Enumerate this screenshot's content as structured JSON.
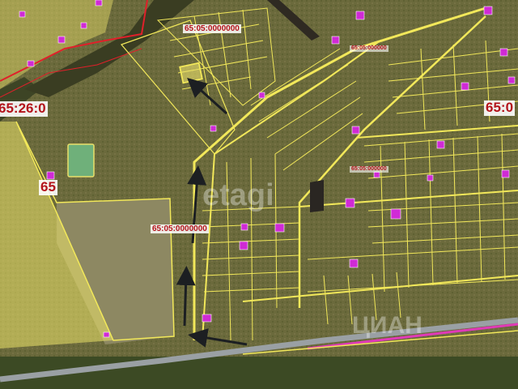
{
  "labels": {
    "parcel_top": "65:05:0000000",
    "parcel_mid": "65:05:0000000",
    "block_small_a": "65:05:000000",
    "block_small_b": "65:05:000000",
    "zone_left": "65:26:0",
    "zone_left_short": "65",
    "zone_right": "65:0"
  },
  "watermark": {
    "center": "etagi",
    "bottom": "ЦИАН"
  },
  "colors": {
    "parcel_line": "#f2e85a",
    "parcel_fill": "#ede36a",
    "building": "#d02ad6",
    "boundary_red": "#e0202a",
    "road_pink": "#e03ab8",
    "label_red": "#b3121a"
  },
  "icons": [
    "arrow-icon",
    "building-marker-icon"
  ]
}
